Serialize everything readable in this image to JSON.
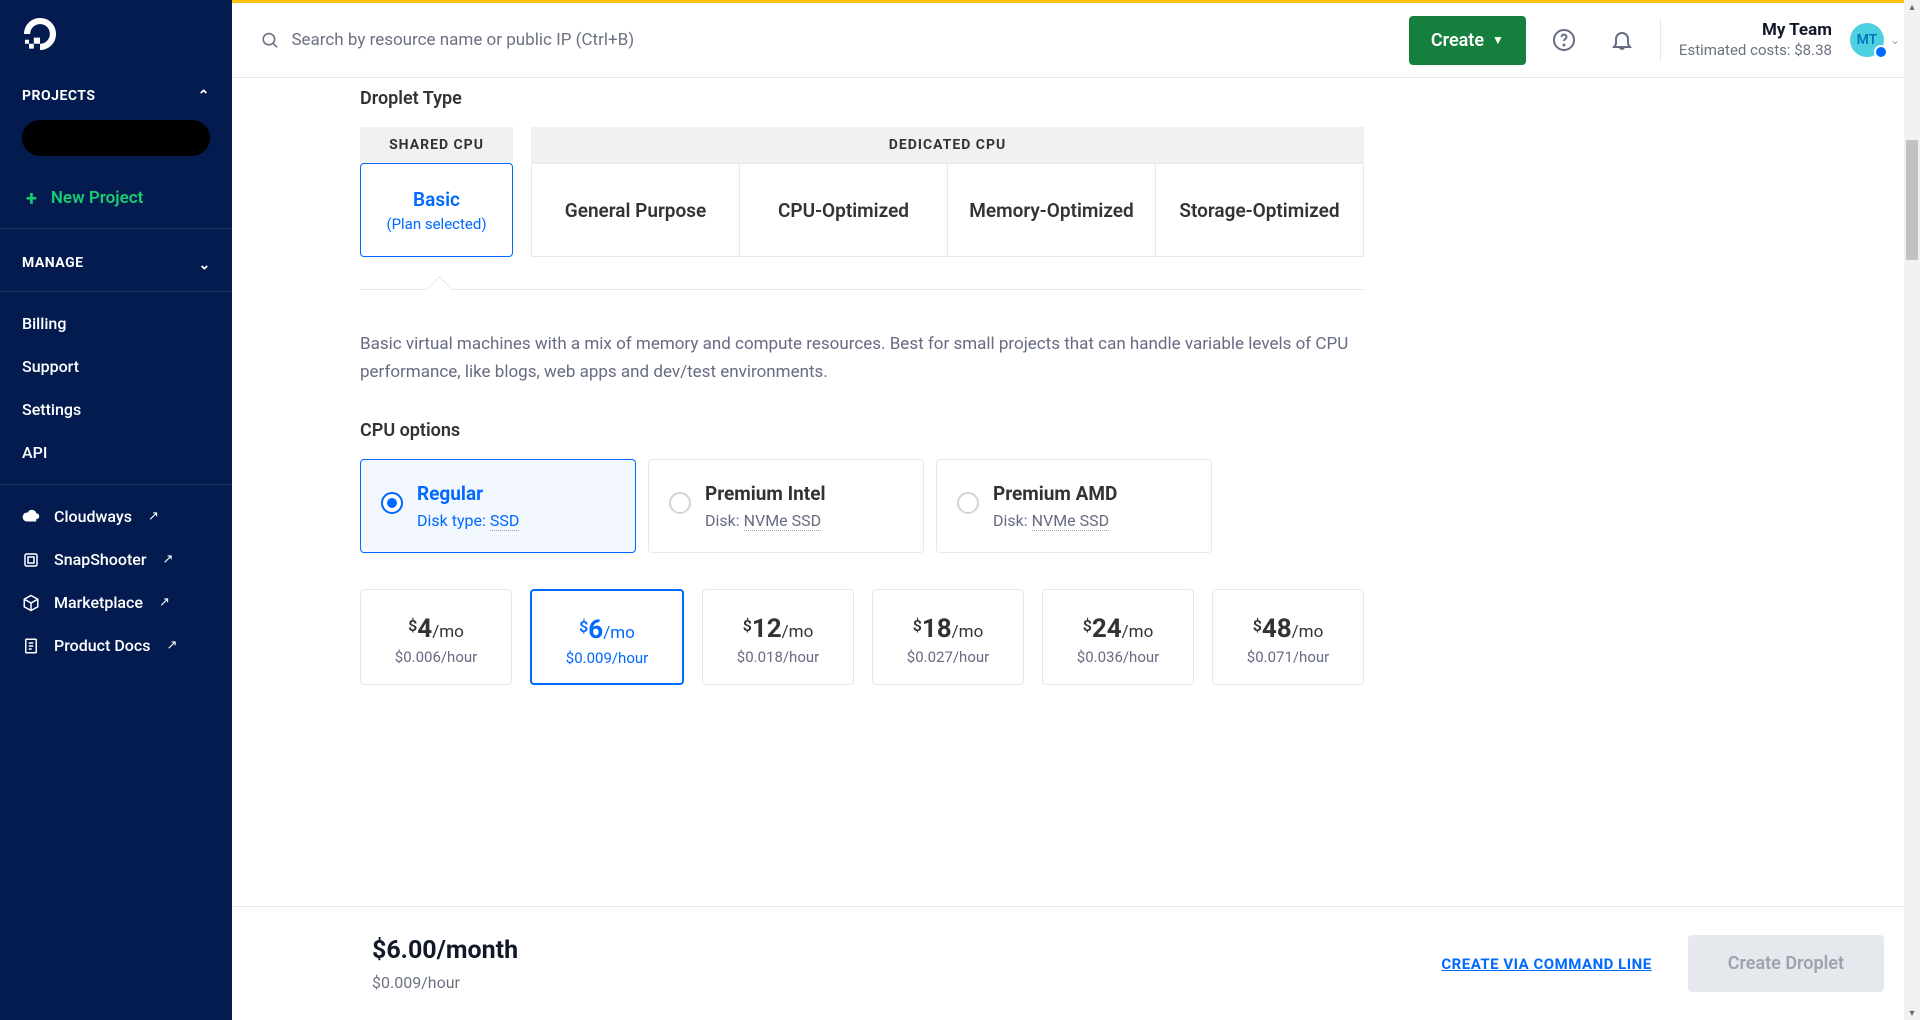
{
  "sidebar": {
    "projects_label": "PROJECTS",
    "new_project": "New Project",
    "manage_label": "MANAGE",
    "manage_items": [
      "Billing",
      "Support",
      "Settings",
      "API"
    ],
    "ext_items": [
      {
        "label": "Cloudways",
        "icon": "cloud"
      },
      {
        "label": "SnapShooter",
        "icon": "snap"
      },
      {
        "label": "Marketplace",
        "icon": "cube"
      },
      {
        "label": "Product Docs",
        "icon": "doc"
      }
    ]
  },
  "topbar": {
    "search_placeholder": "Search by resource name or public IP (Ctrl+B)",
    "create": "Create",
    "team_name": "My Team",
    "cost_label": "Estimated costs: ",
    "cost_value": "$8.38",
    "avatar": "MT"
  },
  "droplet": {
    "type_label": "Droplet Type",
    "shared_hdr": "SHARED CPU",
    "dedicated_hdr": "DEDICATED CPU",
    "basic": "Basic",
    "basic_sub": "(Plan selected)",
    "dedicated_types": [
      "General Purpose",
      "CPU-Optimized",
      "Memory-Optimized",
      "Storage-Optimized"
    ],
    "description": "Basic virtual machines with a mix of memory and compute resources. Best for small projects that can handle variable levels of CPU performance, like blogs, web apps and dev/test environments.",
    "cpu_opts_label": "CPU options",
    "cpu_options": [
      {
        "title": "Regular",
        "disk_prefix": "Disk type: ",
        "disk": "SSD",
        "selected": true
      },
      {
        "title": "Premium Intel",
        "disk_prefix": "Disk: ",
        "disk": "NVMe SSD",
        "selected": false
      },
      {
        "title": "Premium AMD",
        "disk_prefix": "Disk: ",
        "disk": "NVMe SSD",
        "selected": false
      }
    ],
    "plans": [
      {
        "price": "4",
        "per": "/mo",
        "hourly": "$0.006/hour",
        "selected": false
      },
      {
        "price": "6",
        "per": "/mo",
        "hourly": "$0.009/hour",
        "selected": true
      },
      {
        "price": "12",
        "per": "/mo",
        "hourly": "$0.018/hour",
        "selected": false
      },
      {
        "price": "18",
        "per": "/mo",
        "hourly": "$0.027/hour",
        "selected": false
      },
      {
        "price": "24",
        "per": "/mo",
        "hourly": "$0.036/hour",
        "selected": false
      },
      {
        "price": "48",
        "per": "/mo",
        "hourly": "$0.071/hour",
        "selected": false
      }
    ]
  },
  "footer": {
    "price": "$6.00/month",
    "hourly": "$0.009/hour",
    "cli": "CREATE VIA COMMAND LINE",
    "create": "Create Droplet"
  }
}
